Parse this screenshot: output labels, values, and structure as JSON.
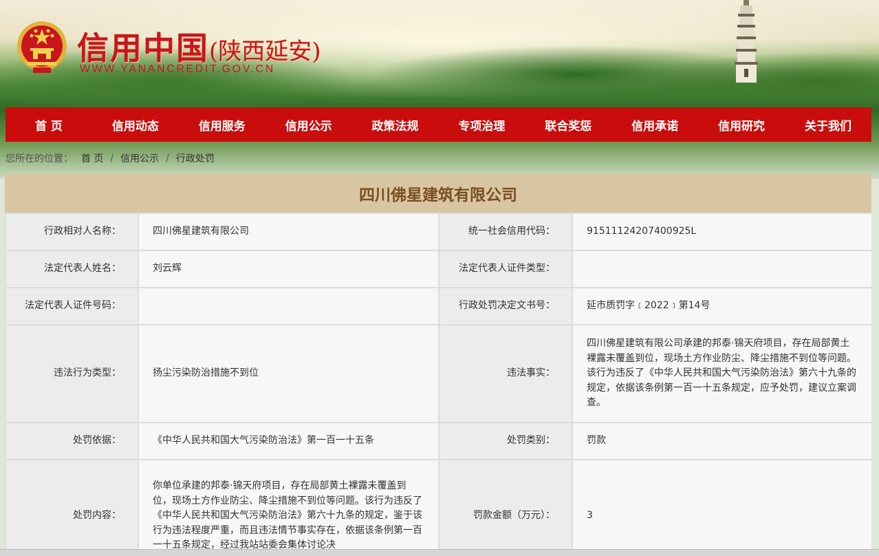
{
  "header": {
    "title_main": "信用中国",
    "title_sub": "(陕西延安)",
    "url": "WWW.YANANCREDIT.GOV.CN",
    "accent": "#c8161d"
  },
  "nav": {
    "items": [
      {
        "label": "首 页"
      },
      {
        "label": "信用动态"
      },
      {
        "label": "信用服务"
      },
      {
        "label": "信用公示"
      },
      {
        "label": "政策法规"
      },
      {
        "label": "专项治理"
      },
      {
        "label": "联合奖惩"
      },
      {
        "label": "信用承诺"
      },
      {
        "label": "信用研究"
      },
      {
        "label": "关于我们"
      }
    ],
    "bg": "#c90d0d"
  },
  "breadcrumb": {
    "lead": "您所在的位置：",
    "items": [
      "首 页",
      "信用公示",
      "行政处罚"
    ],
    "sep": "/"
  },
  "detail": {
    "title": "四川佛星建筑有限公司",
    "rows": [
      {
        "l1": "行政相对人名称：",
        "v1": "四川佛星建筑有限公司",
        "l2": "统一社会信用代码：",
        "v2": "91511124207400925L"
      },
      {
        "l1": "法定代表人姓名：",
        "v1": "刘云辉",
        "l2": "法定代表人证件类型：",
        "v2": ""
      },
      {
        "l1": "法定代表人证件号码：",
        "v1": "",
        "l2": "行政处罚决定文书号：",
        "v2": "延市质罚字﹝2022﹞第14号"
      },
      {
        "l1": "违法行为类型：",
        "v1": "扬尘污染防治措施不到位",
        "l2": "违法事实：",
        "v2": "四川佛星建筑有限公司承建的邦泰·锦天府项目，存在局部黄土裸露未覆盖到位，现场土方作业防尘、降尘措施不到位等问题。该行为违反了《中华人民共和国大气污染防治法》第六十九条的规定，依据该条例第一百一十五条规定，应予处罚，建议立案调查。"
      },
      {
        "l1": "处罚依据：",
        "v1": "《中华人民共和国大气污染防治法》第一百一十五条",
        "l2": "处罚类别：",
        "v2": "罚款"
      },
      {
        "l1": "处罚内容：",
        "v1": "你单位承建的邦泰·锦天府项目，存在局部黄土裸露未覆盖到位，现场土方作业防尘、降尘措施不到位等问题。该行为违反了《中华人民共和国大气污染防治法》第六十九条的规定，鉴于该行为违法程度严重，而且违法情节事实存在，依据该条例第一百一十五条规定，经过我站站委会集体讨论决",
        "l2": "罚款金额（万元）：",
        "v2": "3"
      }
    ]
  }
}
